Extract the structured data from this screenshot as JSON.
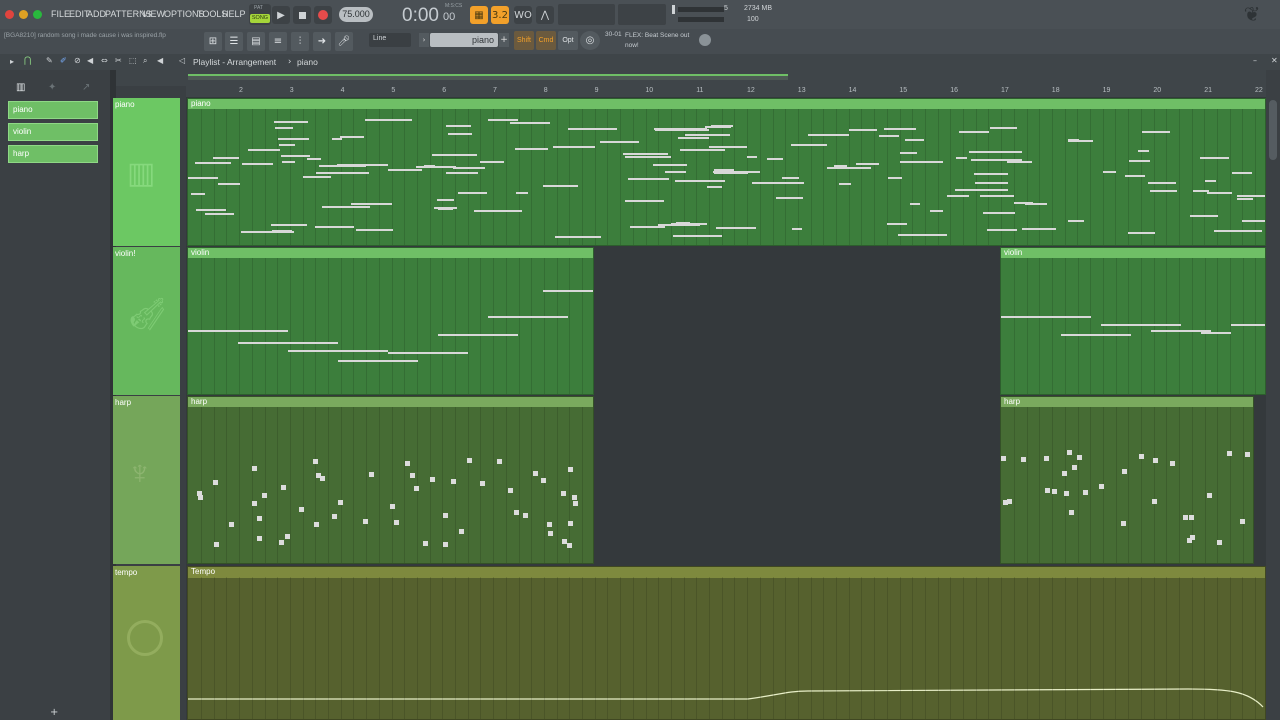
{
  "menu": {
    "items": [
      "FILE",
      "EDIT",
      "ADD",
      "PATTERNS",
      "VIEW",
      "OPTIONS",
      "TOOLS",
      "HELP"
    ]
  },
  "transport": {
    "pat_label": "PAT",
    "song_label": "SONG",
    "tempo": "75.000",
    "time_main": "0:00",
    "time_sub": "00",
    "time_label": "M:S:CS"
  },
  "stats": {
    "cpu": "5",
    "memory": "2734 MB",
    "poly": "100"
  },
  "project": {
    "name": "[BGA8210] random song i made cause i was inspired.flp"
  },
  "tools": {
    "snap": "Line",
    "pattern_name": "piano",
    "shift_label": "Shift",
    "cmd_label": "Cmd",
    "opt_label": "Opt"
  },
  "news": {
    "date": "30-01",
    "text": "FLEX: Beat Scene out now!"
  },
  "playlist": {
    "title": "Playlist - Arrangement",
    "pattern": "piano",
    "label_sep": "›"
  },
  "patterns": [
    "piano",
    "violin",
    "harp"
  ],
  "tracks": [
    {
      "name": "piano",
      "clip": "piano"
    },
    {
      "name": "violin!",
      "clip": "violin"
    },
    {
      "name": "harp",
      "clip": "harp"
    },
    {
      "name": "tempo",
      "clip": "Tempo"
    }
  ],
  "ruler": [
    "2",
    "3",
    "4",
    "5",
    "6",
    "7",
    "8",
    "9",
    "10",
    "11",
    "12",
    "13",
    "14",
    "15",
    "16",
    "17",
    "18",
    "19",
    "20",
    "21",
    "22"
  ],
  "colors": {
    "green": "#6fbf66",
    "track_bg": "#3c7e3c",
    "tempo": "#6b7a38"
  },
  "icons": [
    "apple-close-icon",
    "play-icon",
    "stop-icon",
    "record-icon",
    "metronome-icon",
    "piano-icon",
    "violin-icon",
    "harp-icon",
    "clock-icon",
    "mic-icon",
    "fl-logo-icon"
  ]
}
